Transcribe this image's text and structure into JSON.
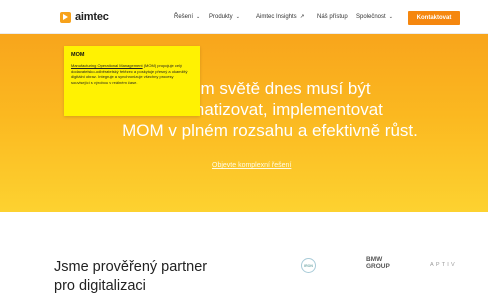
{
  "nav": {
    "logo_text": "aimtec",
    "items": [
      {
        "label": "Řešení",
        "dropdown": true
      },
      {
        "label": "Produkty",
        "dropdown": true
      },
      {
        "label": "Aimtec Insights",
        "external": true
      },
      {
        "label": "Náš přístup"
      },
      {
        "label": "Společnost",
        "dropdown": true
      }
    ],
    "cta_label": "Kontaktovat",
    "accent_color": "#f5870f"
  },
  "hero": {
    "headline": [
      "celém světě dnes musí být",
      "automatizovat, implementovat",
      "MOM v plném rozsahu a efektivně růst."
    ],
    "link": "Objevte komplexní řešení",
    "gradient_colors": [
      "#f8a51c",
      "#fdd230"
    ]
  },
  "tooltip": {
    "title": "MOM",
    "term": "Manufacturing Operational Management",
    "abbr": " (MOM)",
    "body": " propojuje celý dodavatelsko-odběratelský řetězec a poskytuje přesný a okamžitý digitální obraz. Integruje a synchronizuje všechny procesy související s výrobou v reálném čase.",
    "background_color": "#fff202"
  },
  "partners": {
    "heading_line1": "Jsme prověřený partner",
    "heading_line2": "pro digitalizaci",
    "logos": [
      "IRON",
      "BMW\nGROUP",
      "APTIV"
    ]
  }
}
